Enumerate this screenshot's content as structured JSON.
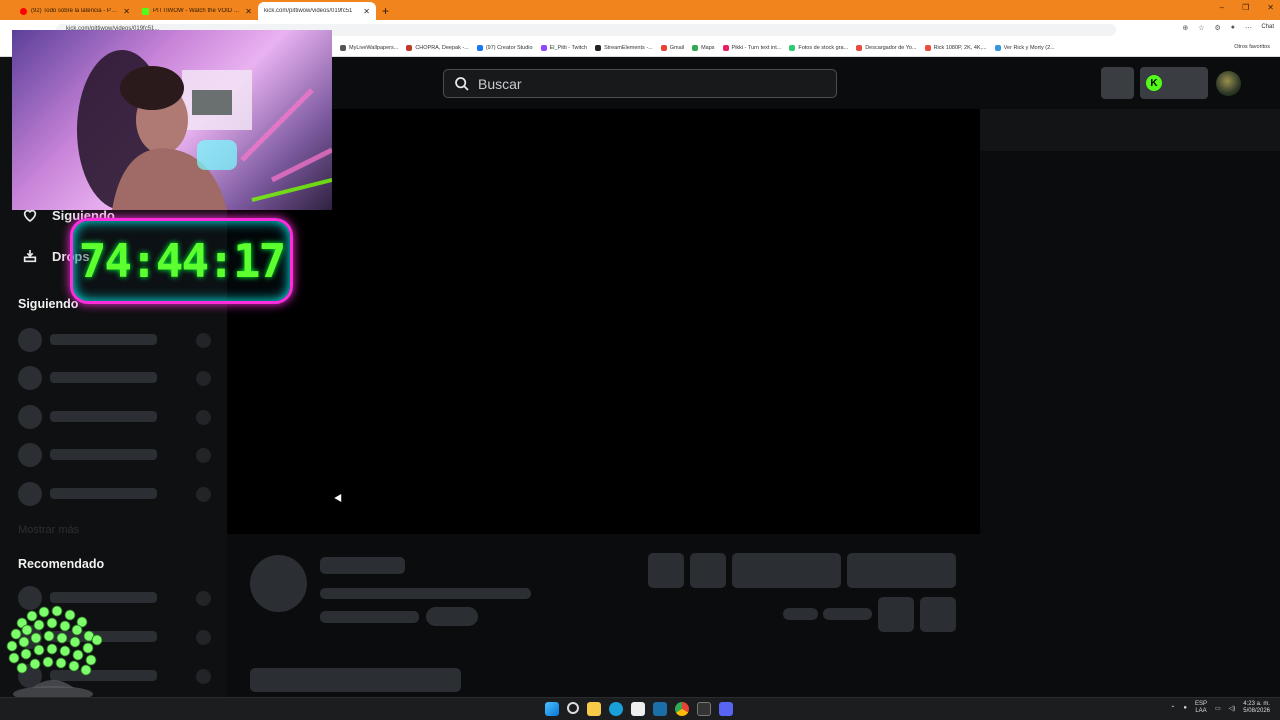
{
  "browser": {
    "tabs": [
      {
        "title": "(92) Todo sobre la latencia - Parte",
        "favicon_color": "#ff0000"
      },
      {
        "title": "PITTIWOW - Watch the VOID on K",
        "favicon_color": "#53fc18"
      },
      {
        "title": "kick.com/pittiwow/videos/019fc51",
        "favicon_color": "#53fc18"
      }
    ],
    "new_tab_symbol": "+",
    "close_symbol": "✕",
    "window_controls": [
      "–",
      "❐",
      "✕"
    ],
    "url": "kick.com/pittiwow/videos/019fc51...",
    "chat_label": "Chat",
    "bookmarks": [
      {
        "label": "MyLiveWallpapers...",
        "color": "#555555"
      },
      {
        "label": "CHOPRA, Deepak -...",
        "color": "#c0392b"
      },
      {
        "label": "(97) Creator Studio",
        "color": "#1877f2"
      },
      {
        "label": "El_Pitti - Twitch",
        "color": "#9146ff"
      },
      {
        "label": "StreamElements -...",
        "color": "#222222"
      },
      {
        "label": "Gmail",
        "color": "#ea4335"
      },
      {
        "label": "Maps",
        "color": "#34a853"
      },
      {
        "label": "Pikki - Turn text int...",
        "color": "#e91e63"
      },
      {
        "label": "Fotos de stock gra...",
        "color": "#2ecc71"
      },
      {
        "label": "Descargador de Yo...",
        "color": "#e74c3c"
      },
      {
        "label": "Rick 1080P, 2K, 4K,...",
        "color": "#e74c3c"
      },
      {
        "label": "Ver Rick y Morty (2...",
        "color": "#3498db"
      }
    ],
    "other_bookmarks": "Otros favoritos"
  },
  "page": {
    "search_placeholder": "Buscar",
    "sidebar": {
      "links": [
        {
          "label": "Siguiendo",
          "icon": "heart-icon"
        },
        {
          "label": "Drops",
          "icon": "drops-icon"
        }
      ],
      "following_title": "Siguiendo",
      "show_more": "Mostrar más",
      "recommended_title": "Recomendado"
    }
  },
  "overlays": {
    "timer": "74:44:17"
  },
  "taskbar": {
    "lang_top": "ESP",
    "lang_bottom": "LAA",
    "time": "4:23 a. m.",
    "date": "5/08/2026"
  }
}
